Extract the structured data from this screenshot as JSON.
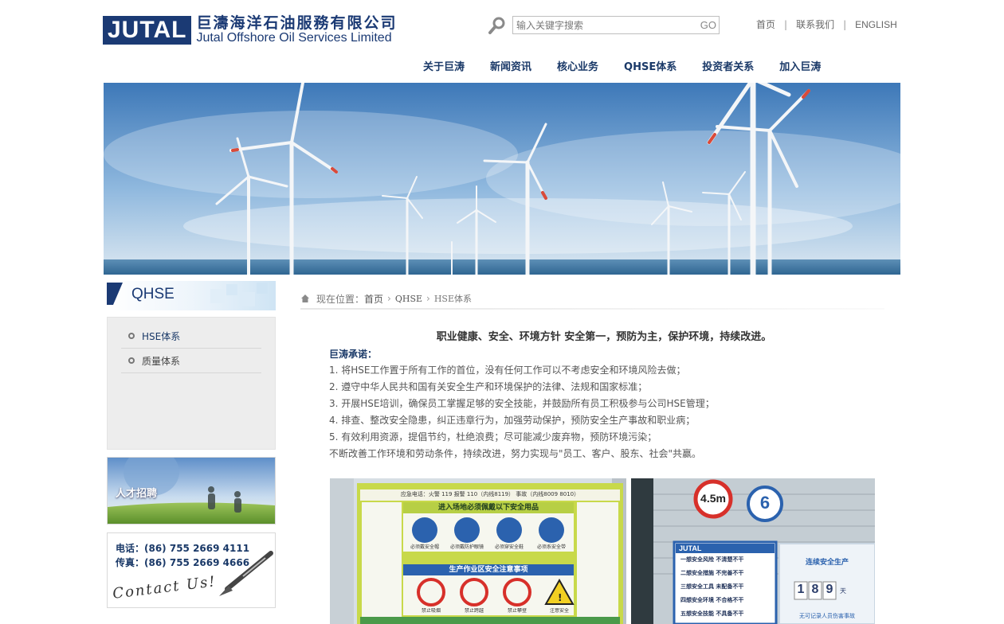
{
  "header": {
    "logo_mark": "JUTAL",
    "logo_cn": "巨濤海洋石油服務有限公司",
    "logo_en": "Jutal Offshore Oil Services Limited",
    "search_placeholder": "输入关键字搜索",
    "search_button": "GO",
    "toplinks": {
      "home": "首页",
      "contact": "联系我们",
      "english": "ENGLISH",
      "separator": "|"
    }
  },
  "nav": {
    "items": [
      "关于巨涛",
      "新闻资讯",
      "核心业务",
      "QHSE体系",
      "投资者关系",
      "加入巨涛"
    ]
  },
  "sidebar": {
    "title": "QHSE",
    "items": [
      {
        "label": "HSE体系",
        "active": true
      },
      {
        "label": "质量体系",
        "active": false
      }
    ],
    "recruit_label": "人才招聘",
    "contact": {
      "phone": "电话：(86) 755 2669 4111",
      "fax": "传真：(86) 755 2669 4666",
      "script_text": "Contact Us!"
    }
  },
  "breadcrumb": {
    "prefix": "现在位置：",
    "home": "首页",
    "level1": "QHSE",
    "current": "HSE体系"
  },
  "article": {
    "policy": "职业健康、安全、环境方针 安全第一，预防为主，保护环境，持续改进。",
    "promise_title": "巨涛承诺：",
    "lines": [
      "1. 将HSE工作置于所有工作的首位，没有任何工作可以不考虑安全和环境风险去做；",
      "2. 遵守中华人民共和国有关安全生产和环境保护的法律、法规和国家标准；",
      "3. 开展HSE培训，确保员工掌握足够的安全技能，并鼓励所有员工积极参与公司HSE管理；",
      "4. 排查、整改安全隐患，纠正违章行为，加强劳动保护，预防安全生产事故和职业病；",
      "5. 有效利用资源，提倡节约，杜绝浪费；尽可能减少废弃物，预防环境污染；",
      "不断改善工作环境和劳动条件，持续改进，努力实现与\"员工、客户、股东、社会\"共赢。"
    ]
  },
  "photos": {
    "sign1": {
      "top_line": "应急电话：火警 119   报警 110（内线8119）   事故（内线8009 8010）",
      "ppe_title": "进入场地必须佩戴以下安全用品",
      "ppe_labels": [
        "必须戴安全帽",
        "必须戴防护眼镜",
        "必须穿安全鞋",
        "必须系安全带"
      ],
      "zone_title": "生产作业区安全注意事项",
      "zone_labels": [
        "禁止吸烟",
        "禁止跨越",
        "禁止攀登",
        "注意安全"
      ]
    },
    "sign2": {
      "height_limit": "4.5m",
      "gate_number": "6",
      "board_title": "JUTAL",
      "board_lines": [
        "一想安全风险  不清楚不干",
        "二想安全措施  不完善不干",
        "三想安全工具  未配备不干",
        "四想安全环境  不合格不干",
        "五想安全技能  不具备不干"
      ],
      "counter_title": "连续安全生产",
      "counter_digits": [
        "1",
        "8",
        "9"
      ],
      "counter_unit": "天",
      "counter_caption": "无可记录人员伤害事故"
    }
  },
  "colors": {
    "brand_navy": "#1b3a74",
    "nav_text": "#1a3968",
    "sidebar_bg": "#ededed"
  }
}
